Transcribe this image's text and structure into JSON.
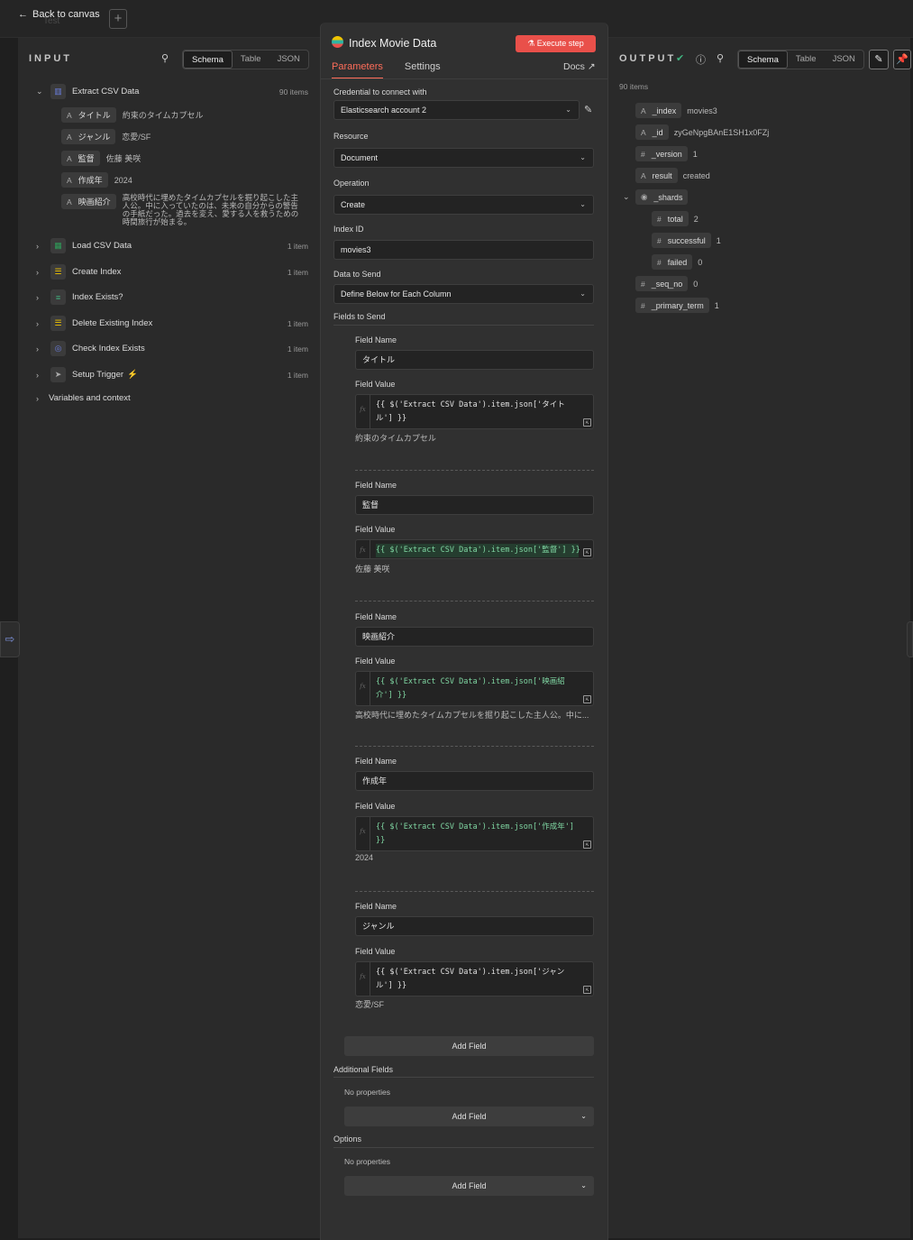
{
  "topbar": {
    "back_label": "Back to canvas",
    "ghost_label": "Test"
  },
  "input": {
    "header": "INPUT",
    "views": [
      "Schema",
      "Table",
      "JSON"
    ],
    "active_view": "Schema",
    "root": {
      "label": "Extract CSV Data",
      "count": "90 items"
    },
    "fields": [
      {
        "type": "A",
        "key": "タイトル",
        "value": "約束のタイムカプセル"
      },
      {
        "type": "A",
        "key": "ジャンル",
        "value": "恋愛/SF"
      },
      {
        "type": "A",
        "key": "監督",
        "value": "佐藤 美咲"
      },
      {
        "type": "A",
        "key": "作成年",
        "value": "2024"
      },
      {
        "type": "A",
        "key": "映画紹介",
        "value": "高校時代に埋めたタイムカプセルを掘り起こした主人公。中に入っていたのは、未来の自分からの警告の手紙だった。過去を変え、愛する人を救うための時間旅行が始まる。"
      }
    ],
    "nodes": [
      {
        "label": "Load CSV Data",
        "count": "1 item",
        "icon_color": "#2f9e59"
      },
      {
        "label": "Create Index",
        "count": "1 item",
        "icon_color": "#f0c400"
      },
      {
        "label": "Index Exists?",
        "count": "",
        "icon_color": "#3fb37f"
      },
      {
        "label": "Delete Existing Index",
        "count": "1 item",
        "icon_color": "#f0c400"
      },
      {
        "label": "Check Index Exists",
        "count": "1 item",
        "icon_color": "#6b7fe0"
      },
      {
        "label": "Setup Trigger",
        "count": "1 item",
        "icon_color": "#aaaaaa"
      }
    ],
    "variables_label": "Variables and context"
  },
  "node": {
    "title": "Index Movie Data",
    "execute_label": "Execute step",
    "tabs": [
      "Parameters",
      "Settings"
    ],
    "active_tab": "Parameters",
    "docs_label": "Docs",
    "credential_label": "Credential to connect with",
    "credential_value": "Elasticsearch account 2",
    "resource_label": "Resource",
    "resource_value": "Document",
    "operation_label": "Operation",
    "operation_value": "Create",
    "index_label": "Index ID",
    "index_value": "movies3",
    "data_label": "Data to Send",
    "data_value": "Define Below for Each Column",
    "fields_label": "Fields to Send",
    "field_name_label": "Field Name",
    "field_value_label": "Field Value",
    "fields": [
      {
        "name": "タイトル",
        "expr_line1": "{{ $('Extract CSV Data').item.json['タイト",
        "expr_line2": "ル'] }}",
        "preview": "約束のタイムカプセル"
      },
      {
        "name": "監督",
        "expr_line1": "{{ $('Extract CSV Data').item.json['監督'] }}",
        "expr_line2": "",
        "preview": "佐藤 美咲"
      },
      {
        "name": "映画紹介",
        "expr_line1": "{{ $('Extract CSV Data').item.json['映画紹",
        "expr_line2": "介'] }}",
        "preview": "高校時代に埋めたタイムカプセルを掘り起こした主人公。中に..."
      },
      {
        "name": "作成年",
        "expr_line1": "{{ $('Extract CSV Data').item.json['作成年']",
        "expr_line2": "}}",
        "preview": "2024"
      },
      {
        "name": "ジャンル",
        "expr_line1": "{{ $('Extract CSV Data').item.json['ジャン",
        "expr_line2": "ル'] }}",
        "preview": "恋愛/SF"
      }
    ],
    "add_field_label": "Add Field",
    "additional_label": "Additional Fields",
    "options_label": "Options",
    "no_properties": "No properties"
  },
  "output": {
    "header": "OUTPUT",
    "views": [
      "Schema",
      "Table",
      "JSON"
    ],
    "active_view": "Schema",
    "count": "90 items",
    "keys": [
      {
        "type": "A",
        "key": "_index",
        "value": "movies3"
      },
      {
        "type": "A",
        "key": "_id",
        "value": "zyGeNpgBAnE1SH1x0FZj"
      },
      {
        "type": "#",
        "key": "_version",
        "value": "1"
      },
      {
        "type": "A",
        "key": "result",
        "value": "created"
      },
      {
        "type": "obj",
        "key": "_shards",
        "value": ""
      },
      {
        "type": "#",
        "key": "total",
        "value": "2"
      },
      {
        "type": "#",
        "key": "successful",
        "value": "1"
      },
      {
        "type": "#",
        "key": "failed",
        "value": "0"
      },
      {
        "type": "#",
        "key": "_seq_no",
        "value": "0"
      },
      {
        "type": "#",
        "key": "_primary_term",
        "value": "1"
      }
    ]
  },
  "colors": {
    "accent": "#ff6d5a",
    "execute": "#e9504a",
    "success": "#3fb37f"
  }
}
